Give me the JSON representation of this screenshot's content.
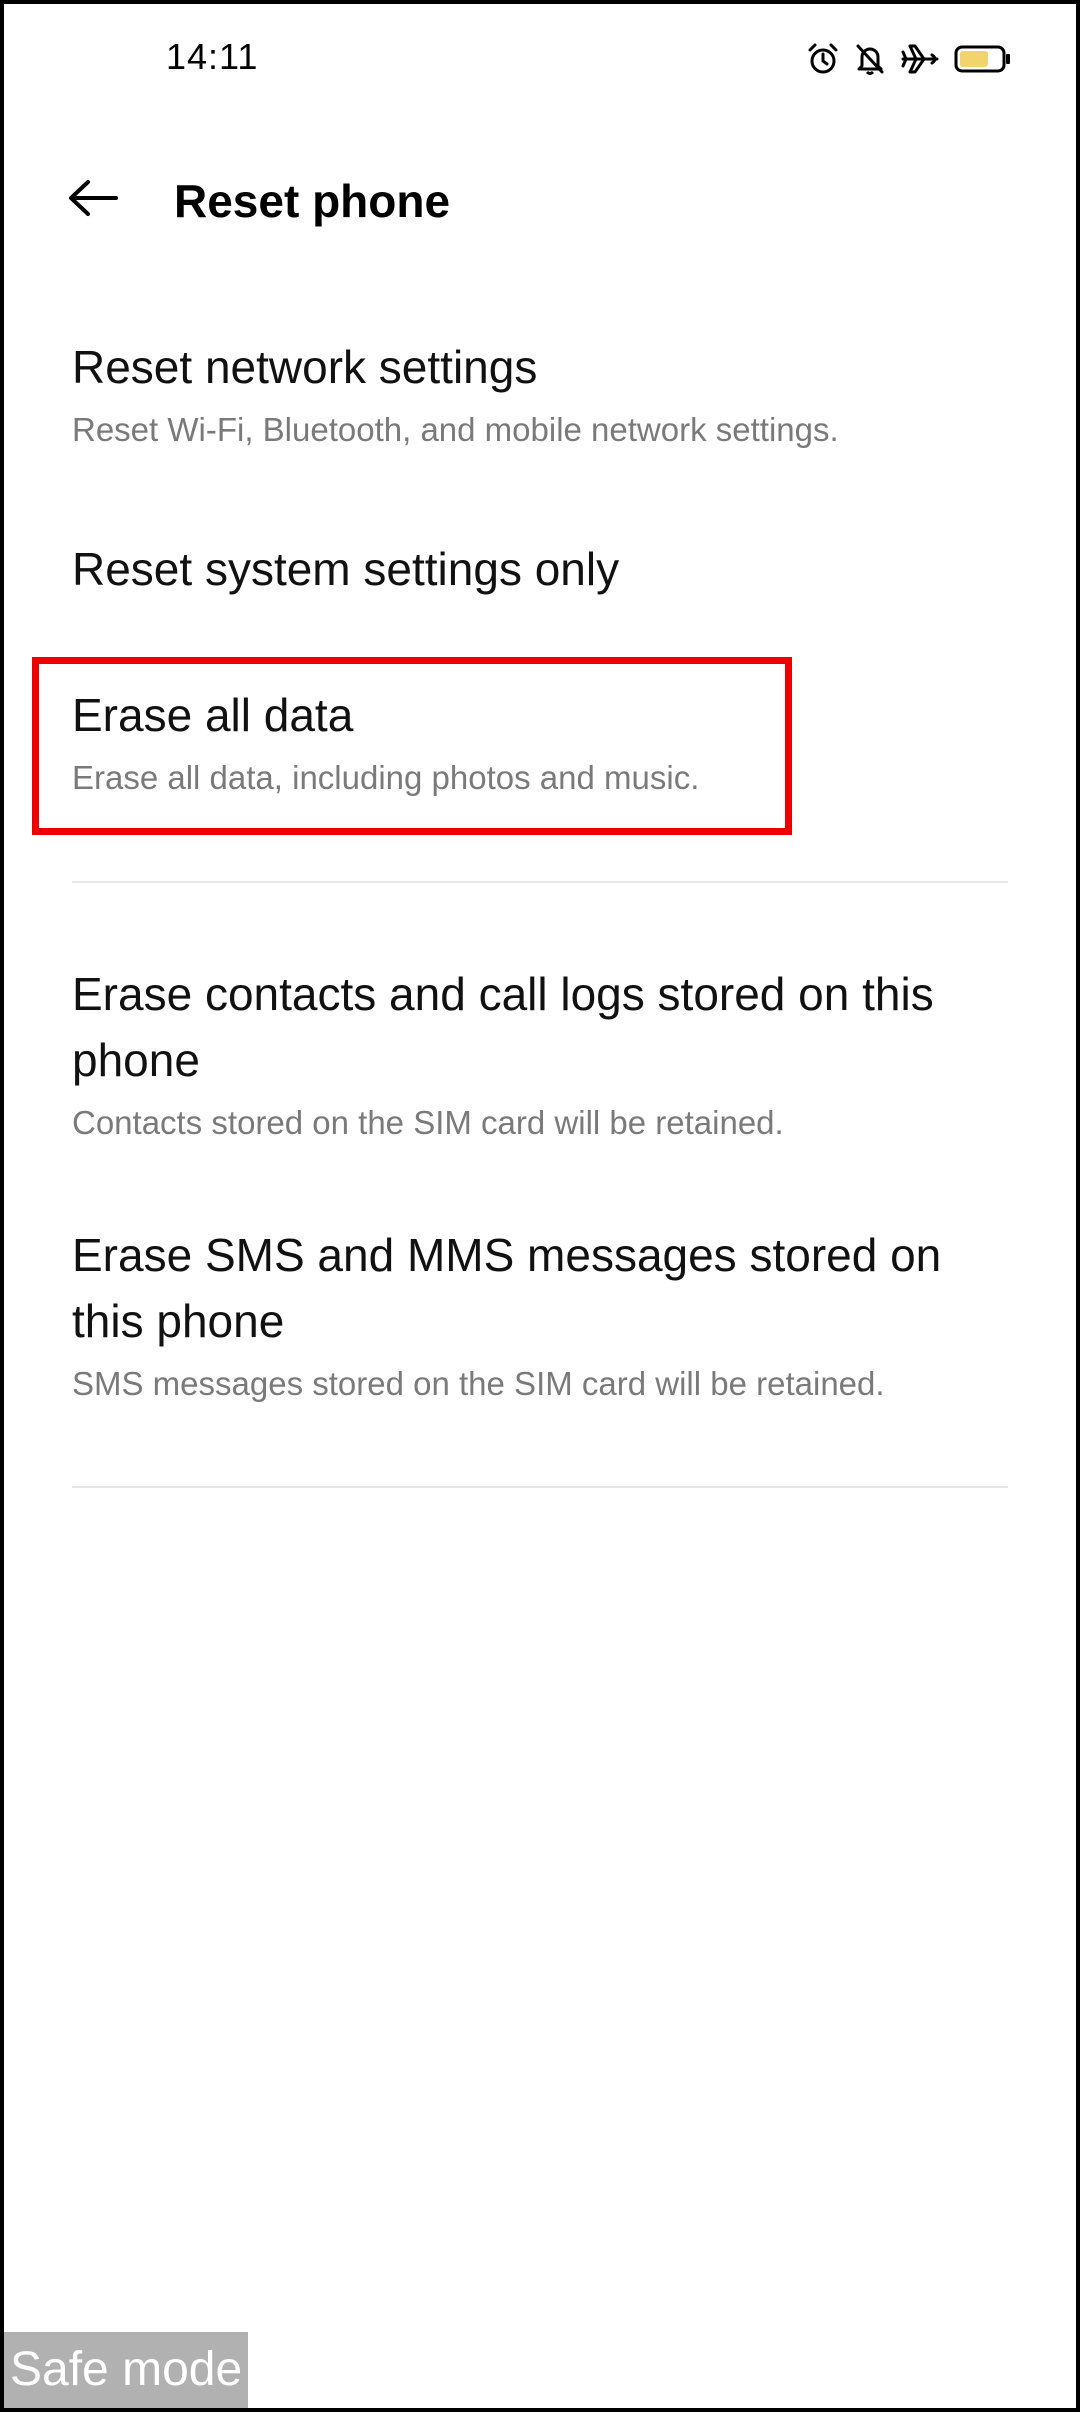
{
  "status_bar": {
    "time": "14:11",
    "icons": [
      "alarm-icon",
      "bell-off-icon",
      "airplane-icon",
      "battery-icon"
    ],
    "battery_color": "#f3d36b"
  },
  "header": {
    "back_icon": "arrow-left-icon",
    "title": "Reset phone"
  },
  "items": [
    {
      "title": "Reset network settings",
      "subtitle": "Reset Wi-Fi, Bluetooth, and mobile network settings."
    },
    {
      "title": "Reset system settings only",
      "subtitle": ""
    },
    {
      "title": "Erase all data",
      "subtitle": "Erase all data, including photos and music."
    },
    {
      "title": "Erase contacts and call logs stored on this phone",
      "subtitle": "Contacts stored on the SIM card will be retained."
    },
    {
      "title": "Erase SMS and MMS messages stored on this phone",
      "subtitle": "SMS messages stored on the SIM card will be retained."
    }
  ],
  "highlight_color": "#ee0000",
  "overlay": {
    "safe_mode_label": "Safe mode"
  }
}
